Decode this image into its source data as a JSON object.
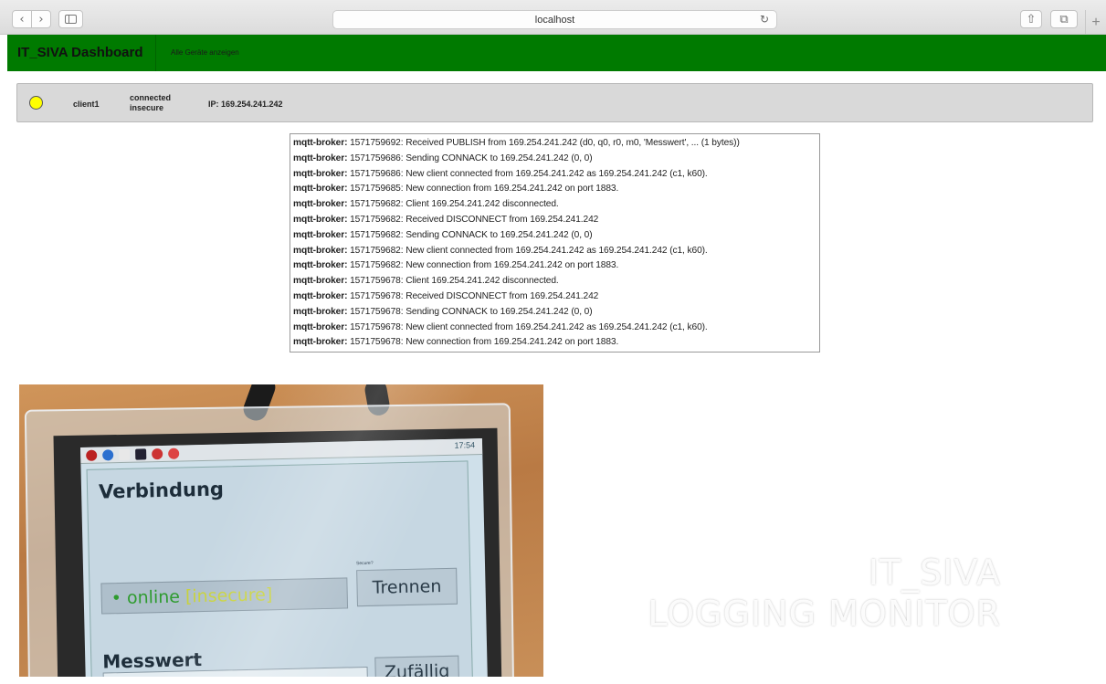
{
  "browser": {
    "back_icon": "chevron-left-icon",
    "back_glyph": "‹",
    "forward_icon": "chevron-right-icon",
    "forward_glyph": "›",
    "sidebar_icon": "sidebar-icon",
    "address": "localhost",
    "reload_glyph": "↻",
    "share_glyph": "⇧",
    "tabs_glyph": "⧉",
    "new_tab_glyph": "+"
  },
  "navbar": {
    "brand": "IT_SIVA Dashboard",
    "link": "Alle Geräte anzeigen",
    "bg_color": "#007a00"
  },
  "device": {
    "status_color": "#ffff00",
    "name": "client1",
    "state_line1": "connected",
    "state_line2": "insecure",
    "ip": "IP: 169.254.241.242"
  },
  "log": {
    "entries": [
      {
        "source": "mqtt-broker:",
        "message": " 1571759692: Received PUBLISH from 169.254.241.242 (d0, q0, r0, m0, 'Messwert', ... (1 bytes))"
      },
      {
        "source": "mqtt-broker:",
        "message": " 1571759686: Sending CONNACK to 169.254.241.242 (0, 0)"
      },
      {
        "source": "mqtt-broker:",
        "message": " 1571759686: New client connected from 169.254.241.242 as 169.254.241.242 (c1, k60)."
      },
      {
        "source": "mqtt-broker:",
        "message": " 1571759685: New connection from 169.254.241.242 on port 1883."
      },
      {
        "source": "mqtt-broker:",
        "message": " 1571759682: Client 169.254.241.242 disconnected."
      },
      {
        "source": "mqtt-broker:",
        "message": " 1571759682: Received DISCONNECT from 169.254.241.242"
      },
      {
        "source": "mqtt-broker:",
        "message": " 1571759682: Sending CONNACK to 169.254.241.242 (0, 0)"
      },
      {
        "source": "mqtt-broker:",
        "message": " 1571759682: New client connected from 169.254.241.242 as 169.254.241.242 (c1, k60)."
      },
      {
        "source": "mqtt-broker:",
        "message": " 1571759682: New connection from 169.254.241.242 on port 1883."
      },
      {
        "source": "mqtt-broker:",
        "message": " 1571759678: Client 169.254.241.242 disconnected."
      },
      {
        "source": "mqtt-broker:",
        "message": " 1571759678: Received DISCONNECT from 169.254.241.242"
      },
      {
        "source": "mqtt-broker:",
        "message": " 1571759678: Sending CONNACK to 169.254.241.242 (0, 0)"
      },
      {
        "source": "mqtt-broker:",
        "message": " 1571759678: New client connected from 169.254.241.242 as 169.254.241.242 (c1, k60)."
      },
      {
        "source": "mqtt-broker:",
        "message": " 1571759678: New connection from 169.254.241.242 on port 1883."
      }
    ]
  },
  "video": {
    "device_screen": {
      "tray_clock": "17:54",
      "title": "Verbindung",
      "secure_checkbox": "Secure?",
      "status_online": "• online",
      "status_insecure": " [insecure]",
      "disconnect_button": "Trennen",
      "measure_title": "Messwert",
      "sent_text": "sendet",
      "random_button": "Zufällig"
    }
  },
  "overlay": {
    "line1": "IT_SIVA",
    "line2": "LOGGING MONITOR"
  }
}
